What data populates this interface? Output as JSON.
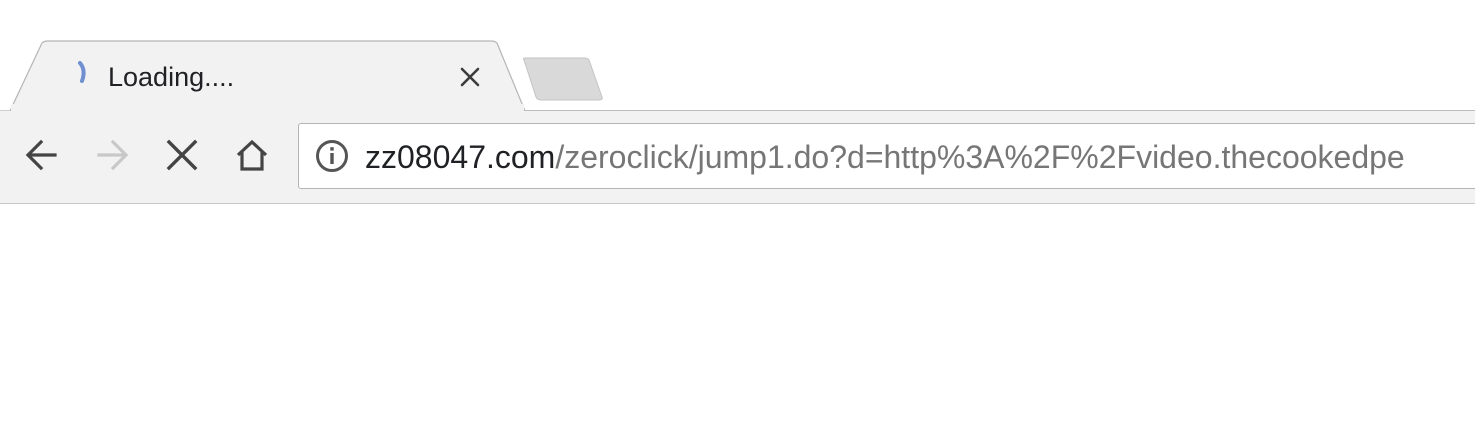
{
  "tab": {
    "title": "Loading....",
    "spinner_icon": "loading-spinner-icon",
    "close_icon": "close-icon"
  },
  "new_tab": {
    "icon": "new-tab-button"
  },
  "toolbar": {
    "back_icon": "arrow-left-icon",
    "forward_icon": "arrow-right-icon",
    "stop_icon": "close-icon",
    "home_icon": "home-icon",
    "forward_enabled": false
  },
  "omnibox": {
    "info_icon": "info-icon",
    "url_host": "zz08047.com",
    "url_path": "/zeroclick/jump1.do?d=http%3A%2F%2Fvideo.thecookedpe"
  },
  "colors": {
    "toolbar_bg": "#f2f2f2",
    "spinner": "#6f8fd0",
    "url_host": "#202124",
    "url_path": "#767676",
    "disabled_icon": "#c8c8c8"
  }
}
